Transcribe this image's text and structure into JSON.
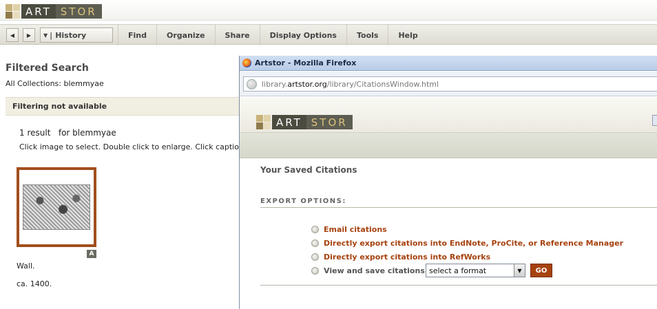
{
  "main": {
    "logo": {
      "part1": "ART",
      "part2": "STOR"
    },
    "toolbar": {
      "back_icon": "back-arrow-icon",
      "forward_icon": "forward-arrow-icon",
      "history_label": "History",
      "menu": [
        "Find",
        "Organize",
        "Share",
        "Display Options",
        "Tools",
        "Help"
      ]
    },
    "search": {
      "title": "Filtered Search",
      "collections": "All Collections: blemmyae",
      "filter_status": "Filtering not available",
      "result_count": "1 result",
      "result_query": "for blemmyae",
      "hint": "Click image to select. Double click to enlarge. Click caption"
    },
    "thumbnail": {
      "badge": "A",
      "caption_title": "Wall.",
      "caption_date": "ca. 1400."
    }
  },
  "popup": {
    "window_title": "Artstor - Mozilla Firefox",
    "url_prefix": "library.",
    "url_domain": "artstor.org",
    "url_path": "/library/CitationsWindow.html",
    "logo": {
      "part1": "ART",
      "part2": "STOR"
    },
    "heading": "Your Saved Citations",
    "export_heading": "Export Options:",
    "options": [
      "Email citations",
      "Directly export citations into EndNote, ProCite, or Reference Manager",
      "Directly export citations into RefWorks",
      "View and save citations:"
    ],
    "format_select": "select a format",
    "go_label": "GO"
  },
  "colors": {
    "accent": "#a6420f",
    "thumb_border": "#a24e1c",
    "logo_dark": "#4b4b40",
    "logo_gold": "#d9c27b"
  }
}
